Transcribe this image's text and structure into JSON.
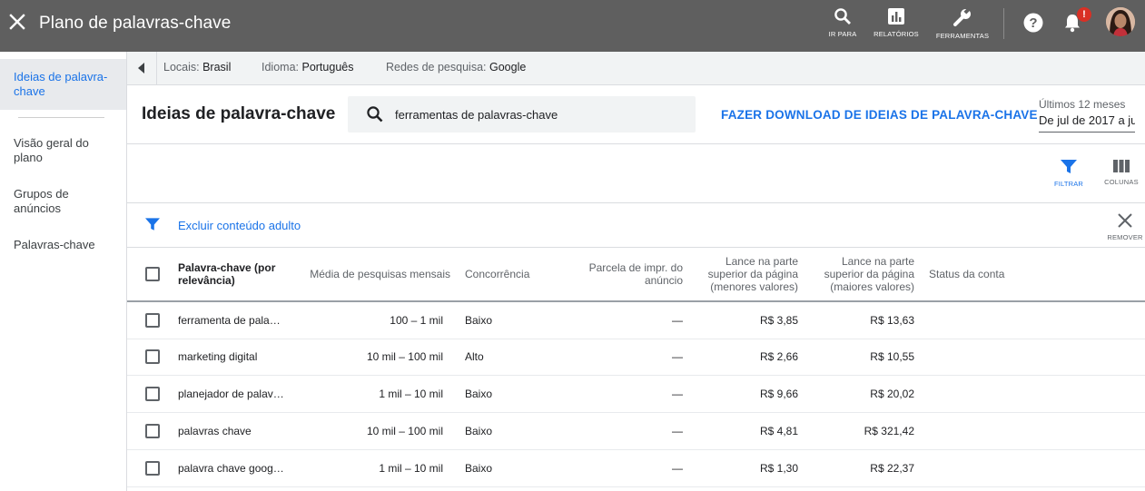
{
  "topbar": {
    "title": "Plano de palavras-chave",
    "tools": [
      {
        "icon": "search-icon",
        "label": "IR PARA"
      },
      {
        "icon": "bar-chart-icon",
        "label": "RELATÓRIOS"
      },
      {
        "icon": "wrench-icon",
        "label": "FERRAMENTAS"
      }
    ],
    "notification_badge": "!"
  },
  "sidebar": {
    "items": [
      {
        "label": "Ideias de palavra-chave",
        "active": true
      },
      {
        "label": "Visão geral do plano"
      },
      {
        "label": "Grupos de anúncios"
      },
      {
        "label": "Palavras-chave"
      }
    ]
  },
  "filters": {
    "locations_label": "Locais:",
    "locations_value": "Brasil",
    "language_label": "Idioma:",
    "language_value": "Português",
    "network_label": "Redes de pesquisa:",
    "network_value": "Google"
  },
  "main": {
    "title": "Ideias de palavra-chave",
    "search_value": "ferramentas de palavras-chave",
    "download_label": "FAZER DOWNLOAD DE IDEIAS DE PALAVRA-CHAVE",
    "date_caption": "Últimos 12 meses",
    "date_range": "De jul de 2017 a ju",
    "filter_label": "FILTRAR",
    "columns_label": "COLUNAS",
    "adult_filter": "Excluir conteúdo adulto",
    "remove_label": "REMOVER"
  },
  "table": {
    "headers": {
      "keyword": "Palavra-chave (por relevância)",
      "searches": "Média de pesquisas mensais",
      "competition": "Concorrência",
      "impr_share": "Parcela de impr. do anúncio",
      "bid_low": "Lance na parte superior da página (menores valores)",
      "bid_high": "Lance na parte superior da página (maiores valores)",
      "status": "Status da conta"
    },
    "rows": [
      {
        "keyword": "ferramenta de pala…",
        "searches": "100 – 1 mil",
        "competition": "Baixo",
        "impr_share": "—",
        "bid_low": "R$ 3,85",
        "bid_high": "R$ 13,63"
      },
      {
        "keyword": "marketing digital",
        "searches": "10 mil – 100 mil",
        "competition": "Alto",
        "impr_share": "—",
        "bid_low": "R$ 2,66",
        "bid_high": "R$ 10,55"
      },
      {
        "keyword": "planejador de palav…",
        "searches": "1 mil – 10 mil",
        "competition": "Baixo",
        "impr_share": "—",
        "bid_low": "R$ 9,66",
        "bid_high": "R$ 20,02"
      },
      {
        "keyword": "palavras chave",
        "searches": "10 mil – 100 mil",
        "competition": "Baixo",
        "impr_share": "—",
        "bid_low": "R$ 4,81",
        "bid_high": "R$ 321,42"
      },
      {
        "keyword": "palavra chave goog…",
        "searches": "1 mil – 10 mil",
        "competition": "Baixo",
        "impr_share": "—",
        "bid_low": "R$ 1,30",
        "bid_high": "R$ 22,37"
      }
    ]
  },
  "colors": {
    "topbar": "#5f5f5f",
    "accent": "#1a73e8",
    "badge": "#d93025"
  }
}
